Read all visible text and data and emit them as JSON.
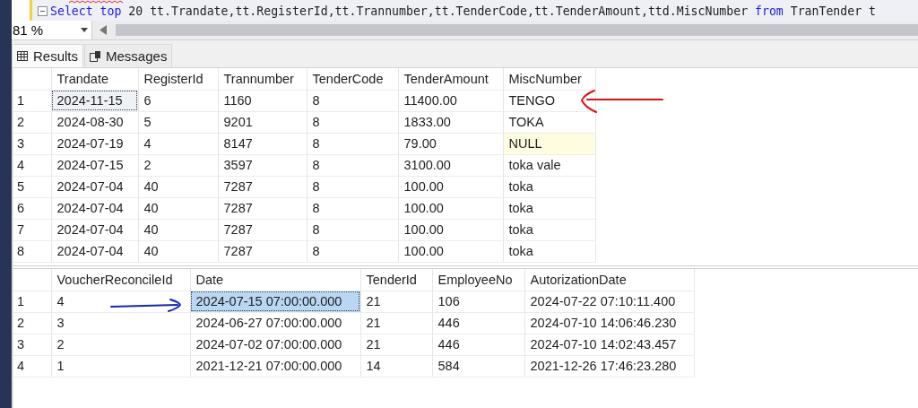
{
  "editor": {
    "query": [
      {
        "kind": "keyword",
        "text": "Select"
      },
      {
        "kind": "keyword",
        "text": " top"
      },
      {
        "kind": "plain",
        "text": " 20 tt.Trandate,tt.RegisterId,tt.Trannumber,tt.TenderCode,tt.TenderAmount,ttd.MiscNumber "
      },
      {
        "kind": "keyword",
        "text": "from"
      },
      {
        "kind": "plain",
        "text": " TranTender t"
      }
    ]
  },
  "zoom": {
    "value": "81 %"
  },
  "tabs": [
    {
      "label": "Results",
      "selected": true
    },
    {
      "label": "Messages",
      "selected": false
    }
  ],
  "grids": [
    {
      "active": false,
      "columns": [
        "Trandate",
        "RegisterId",
        "Trannumber",
        "TenderCode",
        "TenderAmount",
        "MiscNumber"
      ],
      "rows": [
        {
          "number": "1",
          "cells": [
            {
              "text": "2024-11-15",
              "selected": true,
              "is_null": false
            },
            {
              "text": "6",
              "selected": false,
              "is_null": false
            },
            {
              "text": "1160",
              "selected": false,
              "is_null": false
            },
            {
              "text": "8",
              "selected": false,
              "is_null": false
            },
            {
              "text": "11400.00",
              "selected": false,
              "is_null": false
            },
            {
              "text": "TENGO",
              "selected": false,
              "is_null": false
            }
          ]
        },
        {
          "number": "2",
          "cells": [
            {
              "text": "2024-08-30",
              "selected": false,
              "is_null": false
            },
            {
              "text": "5",
              "selected": false,
              "is_null": false
            },
            {
              "text": "9201",
              "selected": false,
              "is_null": false
            },
            {
              "text": "8",
              "selected": false,
              "is_null": false
            },
            {
              "text": "1833.00",
              "selected": false,
              "is_null": false
            },
            {
              "text": "TOKA",
              "selected": false,
              "is_null": false
            }
          ]
        },
        {
          "number": "3",
          "cells": [
            {
              "text": "2024-07-19",
              "selected": false,
              "is_null": false
            },
            {
              "text": "4",
              "selected": false,
              "is_null": false
            },
            {
              "text": "8147",
              "selected": false,
              "is_null": false
            },
            {
              "text": "8",
              "selected": false,
              "is_null": false
            },
            {
              "text": "79.00",
              "selected": false,
              "is_null": false
            },
            {
              "text": "NULL",
              "selected": false,
              "is_null": true
            }
          ]
        },
        {
          "number": "4",
          "cells": [
            {
              "text": "2024-07-15",
              "selected": false,
              "is_null": false
            },
            {
              "text": "2",
              "selected": false,
              "is_null": false
            },
            {
              "text": "3597",
              "selected": false,
              "is_null": false
            },
            {
              "text": "8",
              "selected": false,
              "is_null": false
            },
            {
              "text": "3100.00",
              "selected": false,
              "is_null": false
            },
            {
              "text": "toka vale",
              "selected": false,
              "is_null": false
            }
          ]
        },
        {
          "number": "5",
          "cells": [
            {
              "text": "2024-07-04",
              "selected": false,
              "is_null": false
            },
            {
              "text": "40",
              "selected": false,
              "is_null": false
            },
            {
              "text": "7287",
              "selected": false,
              "is_null": false
            },
            {
              "text": "8",
              "selected": false,
              "is_null": false
            },
            {
              "text": "100.00",
              "selected": false,
              "is_null": false
            },
            {
              "text": "toka",
              "selected": false,
              "is_null": false
            }
          ]
        },
        {
          "number": "6",
          "cells": [
            {
              "text": "2024-07-04",
              "selected": false,
              "is_null": false
            },
            {
              "text": "40",
              "selected": false,
              "is_null": false
            },
            {
              "text": "7287",
              "selected": false,
              "is_null": false
            },
            {
              "text": "8",
              "selected": false,
              "is_null": false
            },
            {
              "text": "100.00",
              "selected": false,
              "is_null": false
            },
            {
              "text": "toka",
              "selected": false,
              "is_null": false
            }
          ]
        },
        {
          "number": "7",
          "cells": [
            {
              "text": "2024-07-04",
              "selected": false,
              "is_null": false
            },
            {
              "text": "40",
              "selected": false,
              "is_null": false
            },
            {
              "text": "7287",
              "selected": false,
              "is_null": false
            },
            {
              "text": "8",
              "selected": false,
              "is_null": false
            },
            {
              "text": "100.00",
              "selected": false,
              "is_null": false
            },
            {
              "text": "toka",
              "selected": false,
              "is_null": false
            }
          ]
        },
        {
          "number": "8",
          "cells": [
            {
              "text": "2024-07-04",
              "selected": false,
              "is_null": false
            },
            {
              "text": "40",
              "selected": false,
              "is_null": false
            },
            {
              "text": "7287",
              "selected": false,
              "is_null": false
            },
            {
              "text": "8",
              "selected": false,
              "is_null": false
            },
            {
              "text": "100.00",
              "selected": false,
              "is_null": false
            },
            {
              "text": "toka",
              "selected": false,
              "is_null": false
            }
          ]
        }
      ]
    },
    {
      "active": true,
      "columns": [
        "VoucherReconcileId",
        "Date",
        "TenderId",
        "EmployeeNo",
        "AutorizationDate"
      ],
      "rows": [
        {
          "number": "1",
          "cells": [
            {
              "text": "4",
              "selected": false,
              "is_null": false
            },
            {
              "text": "2024-07-15 07:00:00.000",
              "selected": true,
              "is_null": false
            },
            {
              "text": "21",
              "selected": false,
              "is_null": false
            },
            {
              "text": "106",
              "selected": false,
              "is_null": false
            },
            {
              "text": "2024-07-22 07:10:11.400",
              "selected": false,
              "is_null": false
            }
          ]
        },
        {
          "number": "2",
          "cells": [
            {
              "text": "3",
              "selected": false,
              "is_null": false
            },
            {
              "text": "2024-06-27 07:00:00.000",
              "selected": false,
              "is_null": false
            },
            {
              "text": "21",
              "selected": false,
              "is_null": false
            },
            {
              "text": "446",
              "selected": false,
              "is_null": false
            },
            {
              "text": "2024-07-10 14:06:46.230",
              "selected": false,
              "is_null": false
            }
          ]
        },
        {
          "number": "3",
          "cells": [
            {
              "text": "2",
              "selected": false,
              "is_null": false
            },
            {
              "text": "2024-07-02 07:00:00.000",
              "selected": false,
              "is_null": false
            },
            {
              "text": "21",
              "selected": false,
              "is_null": false
            },
            {
              "text": "446",
              "selected": false,
              "is_null": false
            },
            {
              "text": "2024-07-10 14:02:43.457",
              "selected": false,
              "is_null": false
            }
          ]
        },
        {
          "number": "4",
          "cells": [
            {
              "text": "1",
              "selected": false,
              "is_null": false
            },
            {
              "text": "2021-12-21 07:00:00.000",
              "selected": false,
              "is_null": false
            },
            {
              "text": "14",
              "selected": false,
              "is_null": false
            },
            {
              "text": "584",
              "selected": false,
              "is_null": false
            },
            {
              "text": "2021-12-26 17:46:23.280",
              "selected": false,
              "is_null": false
            }
          ]
        }
      ]
    }
  ]
}
